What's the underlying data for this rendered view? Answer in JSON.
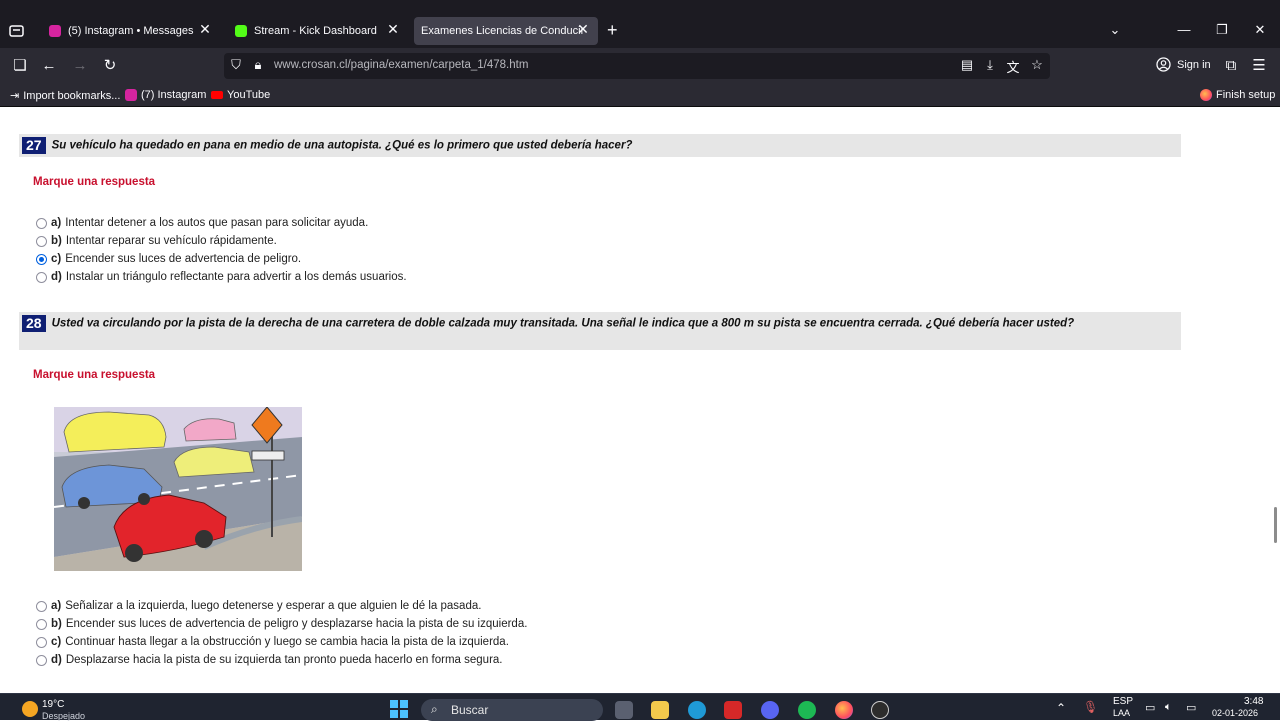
{
  "browser": {
    "tabs": [
      {
        "label": "(5) Instagram • Messages",
        "favicon_color": "#d6249f"
      },
      {
        "label": "Stream - Kick Dashboard",
        "favicon_color": "#53fc18"
      },
      {
        "label": "Examenes Licencias de Conducir",
        "favicon_color": ""
      }
    ],
    "url": "www.crosan.cl/pagina/examen/carpeta_1/478.htm",
    "signin_label": "Sign in",
    "bookmarks": [
      {
        "label": "Import bookmarks..."
      },
      {
        "label": "(7) Instagram"
      },
      {
        "label": "YouTube"
      }
    ],
    "finish_setup_label": "Finish setup"
  },
  "questions": [
    {
      "number": "27",
      "text": "Su vehículo ha quedado en pana en medio de una autopista. ¿Qué es lo primero que usted debería hacer?",
      "instruction": "Marque una respuesta",
      "options": [
        {
          "letter": "a)",
          "text": "Intentar detener a los autos que pasan para solicitar ayuda.",
          "selected": false
        },
        {
          "letter": "b)",
          "text": "Intentar reparar su vehículo rápidamente.",
          "selected": false
        },
        {
          "letter": "c)",
          "text": "Encender sus luces de advertencia de peligro.",
          "selected": true
        },
        {
          "letter": "d)",
          "text": "Instalar un triángulo reflectante para advertir a los demás usuarios.",
          "selected": false
        }
      ]
    },
    {
      "number": "28",
      "text": "Usted va circulando por la pista de la derecha de una carretera de doble calzada muy transitada. Una señal le indica que a 800 m su pista se encuentra cerrada. ¿Qué debería hacer usted?",
      "instruction": "Marque una respuesta",
      "options": [
        {
          "letter": "a)",
          "text": "Señalizar a la izquierda, luego detenerse y esperar a que alguien le dé la pasada.",
          "selected": false
        },
        {
          "letter": "b)",
          "text": "Encender sus luces de advertencia de peligro y desplazarse hacia la pista de su izquierda.",
          "selected": false
        },
        {
          "letter": "c)",
          "text": "Continuar hasta llegar a la obstrucción y luego se cambia hacia la pista de la izquierda.",
          "selected": false
        },
        {
          "letter": "d)",
          "text": "Desplazarse hacia la pista de su izquierda tan pronto pueda hacerlo en forma segura.",
          "selected": false
        }
      ]
    }
  ],
  "taskbar": {
    "weather_temp": "19°C",
    "weather_desc": "Despejado",
    "search_placeholder": "Buscar",
    "language": "ESP",
    "language_sub": "LAA",
    "time": "3:48",
    "date": "02-01-2026"
  },
  "colors": {
    "question_number_bg": "#0f1f73",
    "instruction_red": "#c8102e",
    "question_header_bg": "#e6e6e6"
  }
}
